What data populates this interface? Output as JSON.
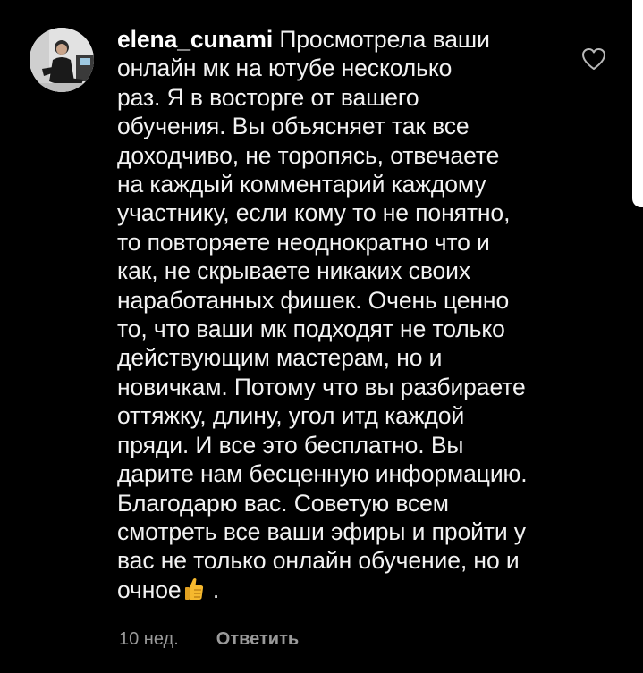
{
  "comment": {
    "username": "elena_cunami",
    "first_line_text": " Просмотрела ваши",
    "lines": [
      "онлайн мк  на  ютубе несколько",
      "раз. Я в восторге от вашего",
      "обучения. Вы объясняет так все",
      "доходчиво, не торопясь, отвечаете",
      "на каждый комментарий каждому",
      "участнику, если кому то не понятно,",
      "то повторяете неоднократно что и",
      "как, не скрываете никаких своих",
      "наработанных фишек. Очень ценно",
      "то, что ваши мк подходят не только",
      "действующим мастерам, но и",
      "новичкам. Потому что вы разбираете",
      "оттяжку, длину, угол итд каждой",
      "пряди. И все это бесплатно. Вы",
      "дарите нам бесценную информацию.",
      "Благодарю вас. Советую всем",
      "смотреть все ваши эфиры и пройти у",
      "вас не только онлайн обучение, но и"
    ],
    "last_line_prefix": "очное",
    "last_line_suffix": " .",
    "emoji": "thumbs-up-icon",
    "time_ago": "10 нед.",
    "reply_label": "Ответить"
  },
  "colors": {
    "background": "#000000",
    "text": "#f2f2f2",
    "meta": "#9a9a9a",
    "emoji_skin": "#f5b82e"
  }
}
